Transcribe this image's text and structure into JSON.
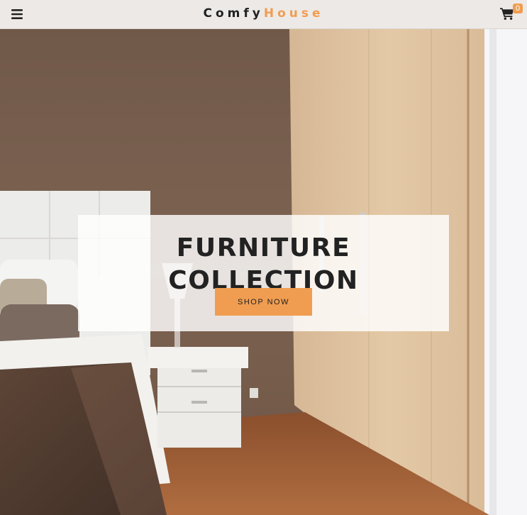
{
  "navbar": {
    "menu_icon": "bars-icon",
    "logo_part1": "Comfy",
    "logo_part2": "House",
    "cart_icon": "shopping-cart-icon",
    "cart_count": "0"
  },
  "banner": {
    "title": "FURNITURE COLLECTION",
    "button_label": "SHOP NOW"
  },
  "colors": {
    "accent": "#f09d51",
    "navbar_bg": "#ede9e6",
    "text_dark": "#222222"
  }
}
